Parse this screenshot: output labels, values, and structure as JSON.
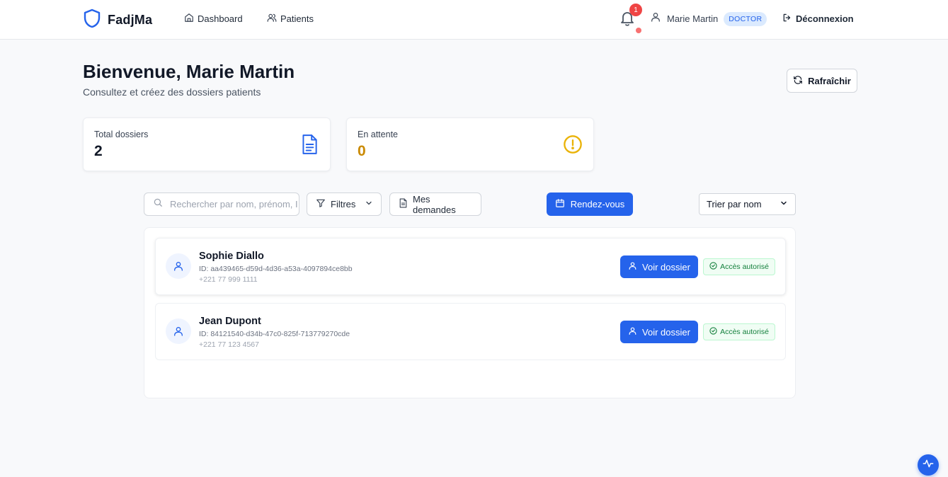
{
  "app": {
    "name": "FadjMa"
  },
  "nav": {
    "dashboard": "Dashboard",
    "patients": "Patients"
  },
  "notifications": {
    "count": "1"
  },
  "user": {
    "name": "Marie Martin",
    "role": "DOCTOR",
    "logout": "Déconnexion"
  },
  "header": {
    "title": "Bienvenue, Marie Martin",
    "subtitle": "Consultez et créez des dossiers patients",
    "refresh_label": "Rafraîchir"
  },
  "stats": [
    {
      "label": "Total dossiers",
      "value": "2",
      "color": "#111827"
    },
    {
      "label": "En attente",
      "value": "0",
      "color": "#ca8a04"
    }
  ],
  "toolbar": {
    "search_placeholder": "Rechercher par nom, prénom, ID...",
    "filters_label": "Filtres",
    "requests_label": "Mes demandes",
    "appointments_label": "Rendez-vous",
    "sort_selected": "Trier par nom"
  },
  "patients": [
    {
      "name": "Sophie Diallo",
      "id": "ID: aa439465-d59d-4d36-a53a-4097894ce8bb",
      "phone": "+221 77 999 1111",
      "action": "Voir dossier",
      "access": "Accès autorisé"
    },
    {
      "name": "Jean Dupont",
      "id": "ID: 84121540-d34b-47c0-825f-713779270cde",
      "phone": "+221 77 123 4567",
      "action": "Voir dossier",
      "access": "Accès autorisé"
    }
  ],
  "colors": {
    "accent": "#2563eb",
    "pending": "#ca8a04",
    "success": "#15803d",
    "danger": "#ef4444"
  }
}
